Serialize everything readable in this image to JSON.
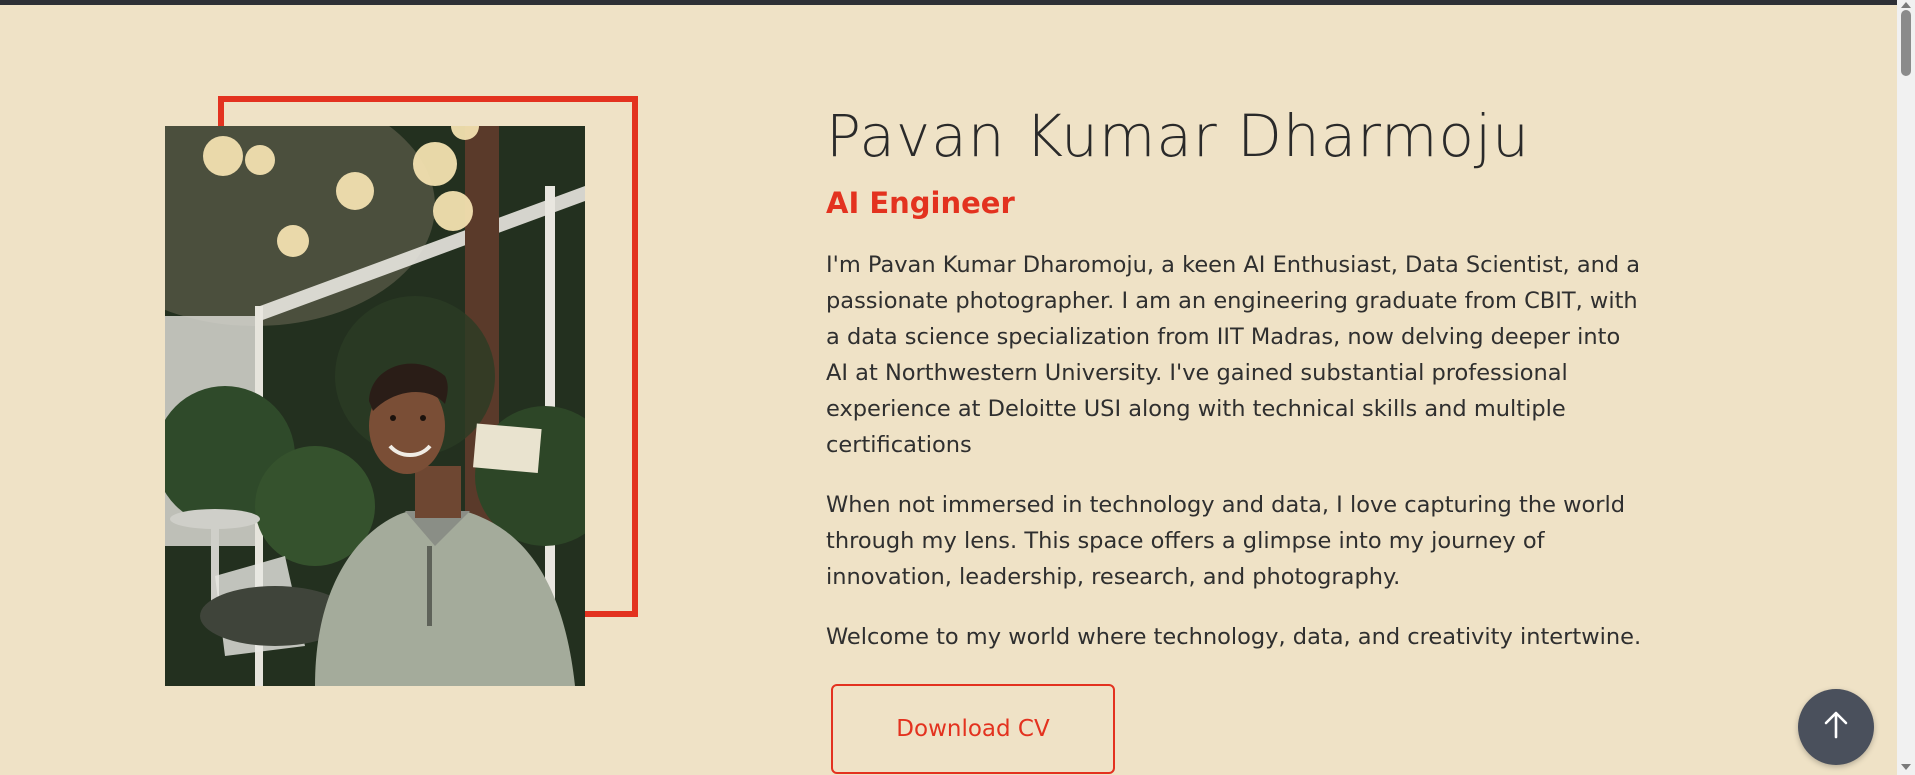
{
  "hero": {
    "name": "Pavan Kumar Dharmoju",
    "role": "AI Engineer",
    "paragraphs": [
      "I'm Pavan Kumar Dharomoju, a keen AI Enthusiast, Data Scientist, and a passionate photographer. I am an engineering graduate from CBIT, with a data science specialization from IIT Madras, now delving deeper into AI at Northwestern University. I've gained substantial professional experience at Deloitte USI along with technical skills and multiple certifications",
      "When not immersed in technology and data, I love capturing the world through my lens. This space offers a glimpse into my journey of innovation, leadership, research, and photography.",
      "Welcome to my world where technology, data, and creativity intertwine."
    ],
    "cv_button_label": "Download CV"
  },
  "icons": {
    "back_to_top": "arrow-up-icon"
  },
  "colors": {
    "background": "#efe2c6",
    "accent": "#e3321f",
    "top_bar": "#2e3036",
    "fab": "#4a505c"
  }
}
